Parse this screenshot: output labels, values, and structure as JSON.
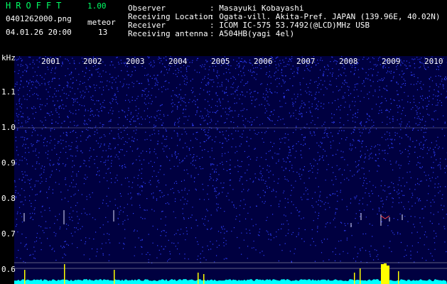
{
  "header": {
    "app_title": "HROFFT",
    "app_version": "1.00",
    "file_name": "0401262000.png",
    "datetime": "04.01.26 20:00",
    "meteor_label": "meteor",
    "meteor_count": "13"
  },
  "info": [
    {
      "label": "Observer",
      "value": ": Masayuki Kobayashi"
    },
    {
      "label": "Receiving Location",
      "value": ": Ogata-vill. Akita-Pref. JAPAN (139.96E, 40.02N)"
    },
    {
      "label": "Receiver",
      "value": ": ICOM IC-575 53.7492(@LCD)MHz USB"
    },
    {
      "label": "Receiving antenna",
      "value": ": A504HB(yagi 4el)"
    }
  ],
  "spectrogram": {
    "y_unit": "kHz",
    "y_ticks": [
      "1.1",
      "1.0",
      "0.9",
      "0.8",
      "0.7",
      "0.6"
    ],
    "x_ticks": [
      "2001",
      "2002",
      "2003",
      "2004",
      "2005",
      "2006",
      "2007",
      "2008",
      "2009",
      "2010"
    ],
    "colors": {
      "background": "#000040",
      "noise": "#3040ff",
      "signal": "#ffff00",
      "baseline": "#00ffff",
      "axis_text": "#ffffff",
      "header_green": "#00ff66"
    }
  }
}
